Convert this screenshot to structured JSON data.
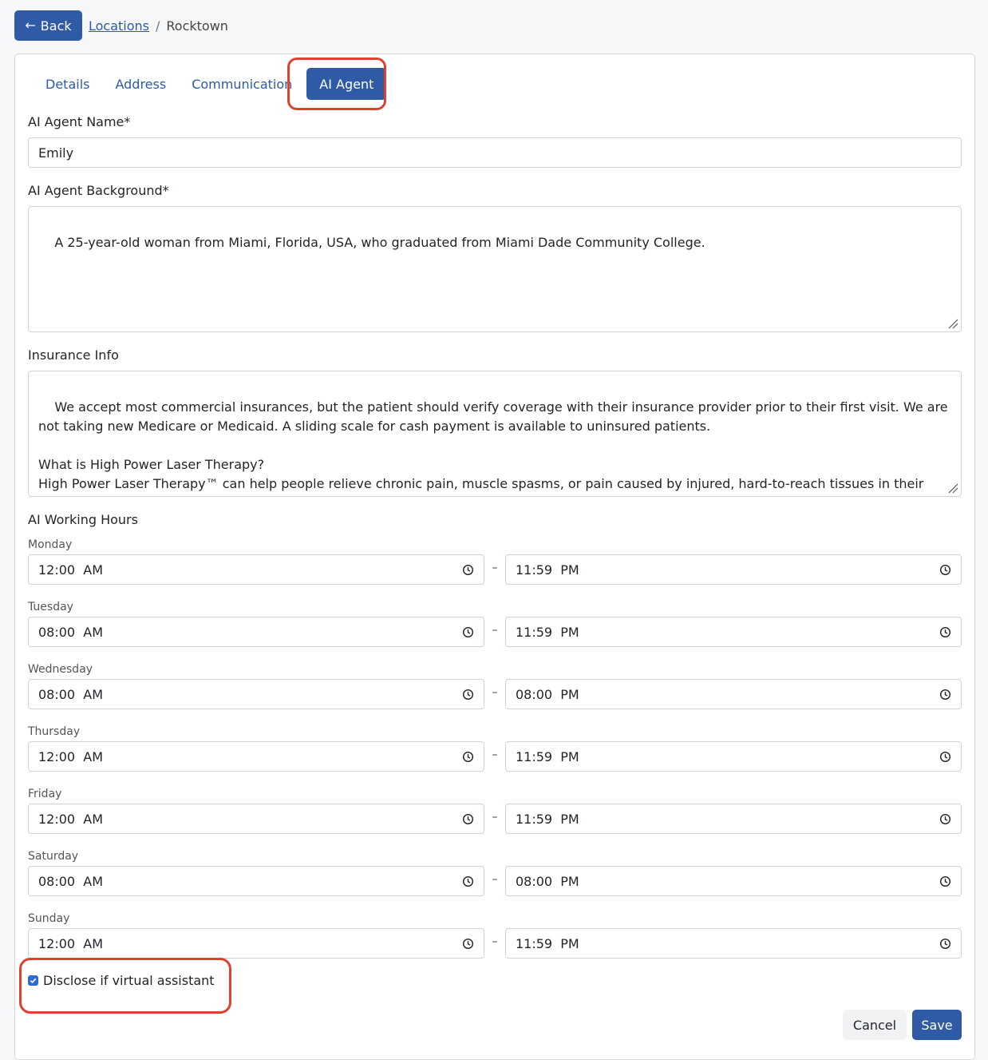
{
  "header": {
    "back_label": "Back",
    "breadcrumb_link": "Locations",
    "breadcrumb_separator": "/",
    "breadcrumb_current": "Rocktown"
  },
  "tabs": [
    {
      "label": "Details"
    },
    {
      "label": "Address"
    },
    {
      "label": "Communication"
    },
    {
      "label": "AI Agent",
      "active": true
    }
  ],
  "form": {
    "agent_name_label": "AI Agent Name*",
    "agent_name_value": "Emily",
    "background_label": "AI Agent Background*",
    "background_value": "A 25-year-old woman from Miami, Florida, USA, who graduated from Miami Dade Community College.",
    "insurance_label": "Insurance Info",
    "insurance_value": "We accept most commercial insurances, but the patient should verify coverage with their insurance provider prior to their first visit. We are not taking new Medicare or Medicaid. A sliding scale for cash payment is available to uninsured patients.\n\nWhat is High Power Laser Therapy?\nHigh Power Laser Therapy™ can help people relieve chronic pain, muscle spasms, or pain caused by injured, hard-to-reach tissues in their muscles or joints.",
    "working_hours_label": "AI Working Hours",
    "days": [
      {
        "day": "Monday",
        "start": "12:00  AM",
        "end": "11:59  PM"
      },
      {
        "day": "Tuesday",
        "start": "08:00  AM",
        "end": "11:59  PM"
      },
      {
        "day": "Wednesday",
        "start": "08:00  AM",
        "end": "08:00  PM"
      },
      {
        "day": "Thursday",
        "start": "12:00  AM",
        "end": "11:59  PM"
      },
      {
        "day": "Friday",
        "start": "12:00  AM",
        "end": "11:59  PM"
      },
      {
        "day": "Saturday",
        "start": "08:00  AM",
        "end": "08:00  PM"
      },
      {
        "day": "Sunday",
        "start": "12:00  AM",
        "end": "11:59  PM"
      }
    ],
    "range_separator": "–",
    "disclose_label": "Disclose if virtual assistant",
    "disclose_checked": true
  },
  "actions": {
    "cancel_label": "Cancel",
    "save_label": "Save"
  },
  "colors": {
    "primary": "#2e5aa6",
    "highlight": "#e0412d"
  }
}
